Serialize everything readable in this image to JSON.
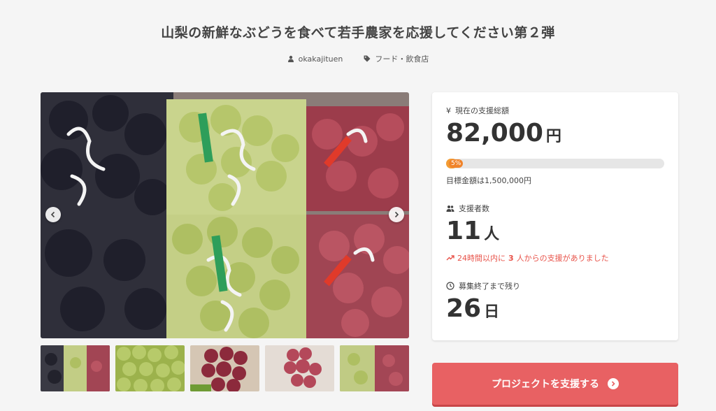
{
  "project": {
    "title": "山梨の新鮮なぶどうを食べて若手農家を応援してください第２弾",
    "author": "okakajituen",
    "category": "フード・飲食店"
  },
  "stats": {
    "total_label": "現在の支援総額",
    "total_value": "82,000",
    "total_unit": "円",
    "progress_percent_text": "5%",
    "progress_fraction": 0.05,
    "goal_text": "目標金額は1,500,000円",
    "supporters_label": "支援者数",
    "supporters_value": "11",
    "supporters_unit": "人",
    "recent_prefix": "24時間以内に",
    "recent_count": "3",
    "recent_suffix": "人からの支援がありました",
    "remaining_label": "募集終了まで残り",
    "remaining_value": "26",
    "remaining_unit": "日"
  },
  "cta": {
    "label": "プロジェクトを支援する"
  },
  "colors": {
    "accent": "#e86163",
    "progress": "#f39c33",
    "trend": "#e8534a"
  },
  "icons": {
    "author": "user-icon",
    "category": "tag-icon",
    "total": "yen-icon",
    "supporters": "users-icon",
    "trend": "trending-up-icon",
    "remaining": "clock-icon",
    "cta": "chevron-right-circle-icon"
  }
}
